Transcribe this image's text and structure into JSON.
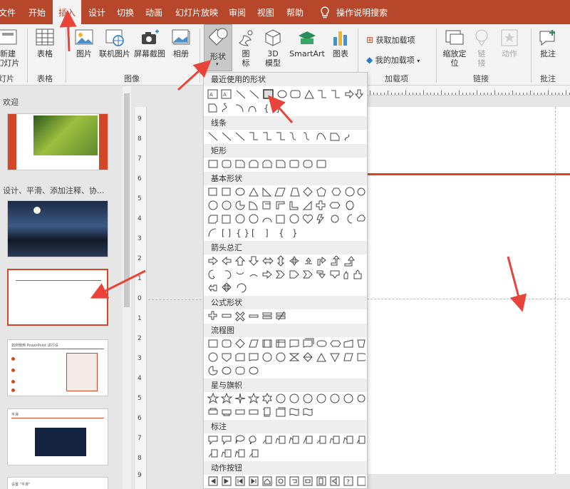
{
  "tabs": [
    "文件",
    "开始",
    "插入",
    "设计",
    "切换",
    "动画",
    "幻灯片放映",
    "审阅",
    "视图",
    "帮助"
  ],
  "search_label": "操作说明搜索",
  "ribbon": {
    "new_slide": "新建\n幻灯片",
    "table": "表格",
    "pictures": "图片",
    "online_pictures": "联机图片",
    "screenshot": "屏幕截图",
    "album": "相册",
    "shapes": "形状",
    "icons": "图\n标",
    "model3d": "3D\n模型",
    "smartart": "SmartArt",
    "chart": "图表",
    "get_addins": "获取加载项",
    "my_addins": "我的加载项",
    "zoom": "缩放定\n位",
    "link": "链\n接",
    "action": "动作",
    "comment": "批注"
  },
  "groups": {
    "slides": "灯片",
    "tables": "表格",
    "images": "图像",
    "addins": "加载项",
    "links": "链接",
    "comments": "批注"
  },
  "slide_panel": {
    "section1": "欢迎",
    "section2": "设计、平滑、添加注释、协...",
    "thumb3_title": "如何使用 PowerPoint 进行设",
    "thumb4_title": "平滑",
    "thumb5_title": "设置 \"平滑\""
  },
  "dropdown": {
    "categories": [
      "最近使用的形状",
      "线条",
      "矩形",
      "基本形状",
      "箭头总汇",
      "公式形状",
      "流程图",
      "星与旗帜",
      "标注",
      "动作按钮"
    ]
  },
  "ruler_numbers": [
    "9",
    "8",
    "7",
    "6",
    "5",
    "4",
    "3",
    "2",
    "1",
    "0",
    "1",
    "2",
    "3",
    "4",
    "5",
    "6",
    "7",
    "8",
    "9"
  ],
  "colors": {
    "accent": "#b7472a",
    "arrow": "#e8443a",
    "selection": "#d24726"
  }
}
